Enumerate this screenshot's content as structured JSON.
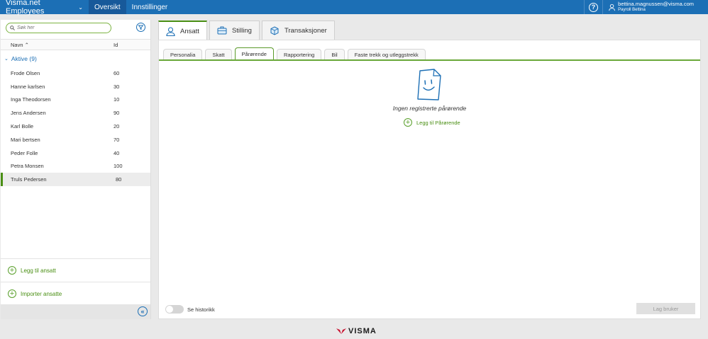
{
  "topbar": {
    "app_name": "Visma.net Employees",
    "nav": [
      "Oversikt",
      "Innstillinger"
    ],
    "help_label": "?",
    "user_email": "bettina.magnussen@visma.com",
    "user_company": "Payroll Bettina"
  },
  "sidebar": {
    "search_placeholder": "Søk her",
    "col_name": "Navn",
    "col_id": "Id",
    "group_label": "Aktive (9)",
    "employees": [
      {
        "name": "Frode Olsen",
        "id": "60"
      },
      {
        "name": "Hanne karlsen",
        "id": "30"
      },
      {
        "name": "Inga Theodorsen",
        "id": "10"
      },
      {
        "name": "Jens Andersen",
        "id": "90"
      },
      {
        "name": "Karl Bolle",
        "id": "20"
      },
      {
        "name": "Mari bertsen",
        "id": "70"
      },
      {
        "name": "Peder Folle",
        "id": "40"
      },
      {
        "name": "Petra Monsen",
        "id": "100"
      },
      {
        "name": "Truls Pedersen",
        "id": "80"
      }
    ],
    "add_employee": "Legg til ansatt",
    "import_employees": "Importer ansatte"
  },
  "main": {
    "tabs": [
      "Ansatt",
      "Stilling",
      "Transaksjoner"
    ],
    "subtabs": [
      "Personalia",
      "Skatt",
      "Pårørende",
      "Rapportering",
      "Bil",
      "Faste trekk og utleggstrekk"
    ],
    "empty_text": "Ingen registrerte pårørende",
    "add_link": "Legg til Pårørende",
    "history_toggle": "Se historikk",
    "create_user_button": "Lag bruker"
  },
  "footer": {
    "logo_text": "VISMA"
  },
  "colors": {
    "topbar": "#1c6fb5",
    "accent_green": "#4a8f14"
  }
}
